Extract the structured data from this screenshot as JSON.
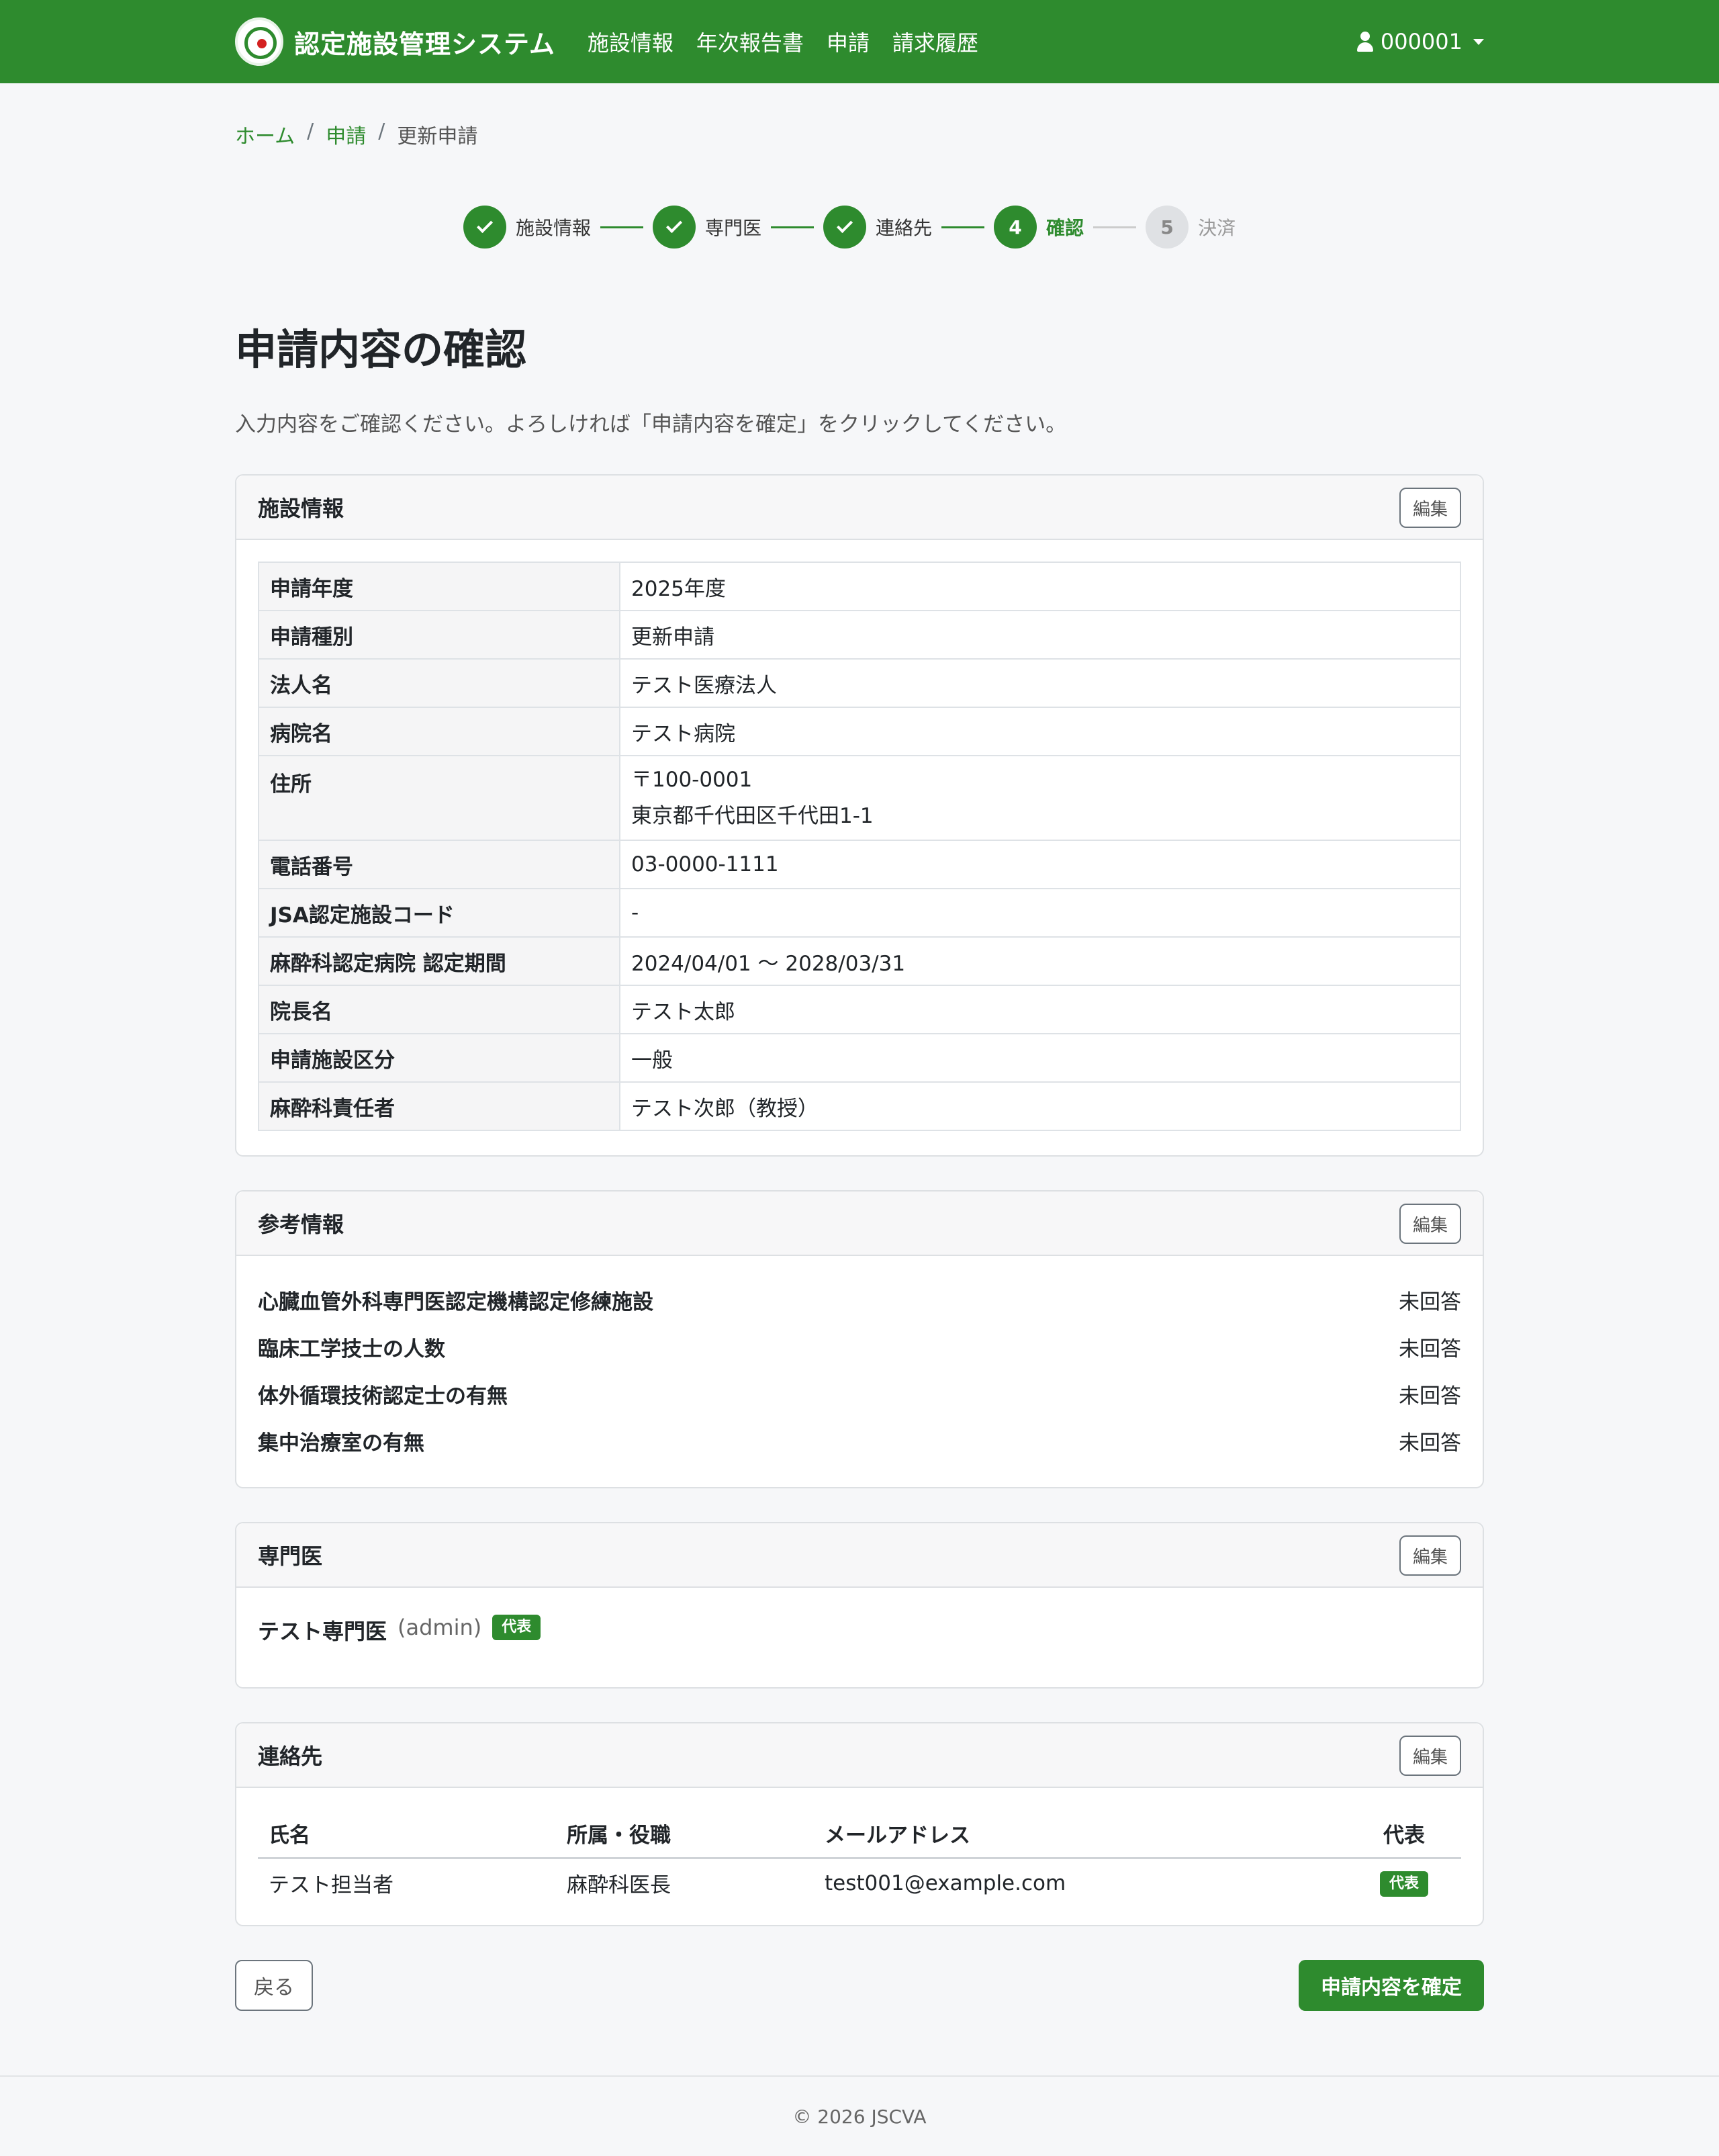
{
  "navbar": {
    "brand": "認定施設管理システム",
    "links": [
      "施設情報",
      "年次報告書",
      "申請",
      "請求履歴"
    ],
    "user": "000001"
  },
  "breadcrumb": {
    "home": "ホーム",
    "apply": "申請",
    "current": "更新申請",
    "separator": "/"
  },
  "stepper": {
    "steps": [
      {
        "label": "施設情報",
        "state": "done"
      },
      {
        "label": "専門医",
        "state": "done"
      },
      {
        "label": "連絡先",
        "state": "done"
      },
      {
        "number": "4",
        "label": "確認",
        "state": "active"
      },
      {
        "number": "5",
        "label": "決済",
        "state": "pending"
      }
    ]
  },
  "page": {
    "title": "申請内容の確認",
    "lead": "入力内容をご確認ください。よろしければ「申請内容を確定」をクリックしてください。"
  },
  "facility": {
    "title": "施設情報",
    "edit_label": "編集",
    "rows": [
      {
        "label": "申請年度",
        "value": "2025年度"
      },
      {
        "label": "申請種別",
        "value": "更新申請"
      },
      {
        "label": "法人名",
        "value": "テスト医療法人"
      },
      {
        "label": "病院名",
        "value": "テスト病院"
      },
      {
        "label": "住所",
        "value": "〒100-0001",
        "value2": "東京都千代田区千代田1-1"
      },
      {
        "label": "電話番号",
        "value": "03-0000-1111"
      },
      {
        "label": "JSA認定施設コード",
        "value": "-"
      },
      {
        "label": "麻酔科認定病院 認定期間",
        "value": "2024/04/01 〜 2028/03/31"
      },
      {
        "label": "院長名",
        "value": "テスト太郎"
      },
      {
        "label": "申請施設区分",
        "value": "一般"
      },
      {
        "label": "麻酔科責任者",
        "value": "テスト次郎（教授）"
      }
    ]
  },
  "reference": {
    "title": "参考情報",
    "edit_label": "編集",
    "items": [
      {
        "question": "心臓血管外科専門医認定機構認定修練施設",
        "answer": "未回答"
      },
      {
        "question": "臨床工学技士の人数",
        "answer": "未回答"
      },
      {
        "question": "体外循環技術認定士の有無",
        "answer": "未回答"
      },
      {
        "question": "集中治療室の有無",
        "answer": "未回答"
      }
    ]
  },
  "specialists": {
    "title": "専門医",
    "edit_label": "編集",
    "name": "テスト専門医",
    "role": "(admin)",
    "badge": "代表"
  },
  "contacts": {
    "title": "連絡先",
    "edit_label": "編集",
    "headers": [
      "氏名",
      "所属・役職",
      "メールアドレス",
      "代表"
    ],
    "rows": [
      {
        "name": "テスト担当者",
        "position": "麻酔科医長",
        "email": "test001@example.com",
        "badge": "代表"
      }
    ]
  },
  "actions": {
    "back": "戻る",
    "confirm": "申請内容を確定"
  },
  "footer": {
    "copyright": "© 2026 JSCVA"
  },
  "colors": {
    "primary": "#2e8b2e",
    "page_bg": "#f6f7f9",
    "pending_step": "#dfe1e4"
  }
}
